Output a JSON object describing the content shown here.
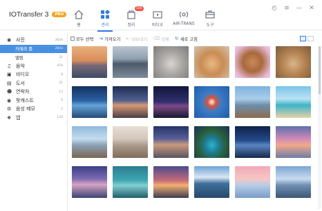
{
  "app": {
    "title": "IOTransfer 3",
    "badge": "PRO"
  },
  "nav": [
    {
      "label": "홈",
      "icon": "home-icon",
      "badge": ""
    },
    {
      "label": "관리",
      "icon": "manage-grid-icon",
      "badge": ""
    },
    {
      "label": "정리",
      "icon": "clean-icon",
      "badge": "500"
    },
    {
      "label": "비디오",
      "icon": "video-icon",
      "badge": ""
    },
    {
      "label": "AIR-TRANS",
      "icon": "air-trans-icon",
      "badge": ""
    },
    {
      "label": "도구",
      "icon": "toolbox-icon",
      "badge": ""
    }
  ],
  "active_nav": "관리",
  "window_controls": [
    "skin-icon",
    "menu-icon",
    "minimize-icon",
    "close-icon"
  ],
  "sidebar": {
    "items": [
      {
        "label": "사진",
        "count": "3644",
        "icon": "camera-icon",
        "sub": false,
        "selected": false
      },
      {
        "label": "카메라 롤",
        "count": "2843",
        "icon": "",
        "sub": true,
        "selected": true
      },
      {
        "label": "앨범",
        "count": "32",
        "icon": "",
        "sub": true,
        "selected": false
      },
      {
        "label": "음악",
        "count": "454",
        "icon": "music-icon",
        "sub": false,
        "selected": false
      },
      {
        "label": "비디오",
        "count": "8",
        "icon": "video-icon",
        "sub": false,
        "selected": false
      },
      {
        "label": "도서",
        "count": "21",
        "icon": "book-icon",
        "sub": false,
        "selected": false
      },
      {
        "label": "연락처",
        "count": "13",
        "icon": "contacts-icon",
        "sub": false,
        "selected": false
      },
      {
        "label": "팟캐스트",
        "count": "8",
        "icon": "podcast-icon",
        "sub": false,
        "selected": false
      },
      {
        "label": "음성 메모",
        "count": "2",
        "icon": "mic-icon",
        "sub": false,
        "selected": false
      },
      {
        "label": "앱",
        "count": "130",
        "icon": "apps-icon",
        "sub": false,
        "selected": false
      }
    ]
  },
  "toolbar": {
    "select_all": "모두 선택",
    "import": "가져오기",
    "export": "내보내기",
    "delete": "삭제",
    "refresh": "새로 고침"
  },
  "colors": {
    "accent": "#2f7be5",
    "selected": "#4a90e2",
    "badge": "#f0533f",
    "pro": "#f5a623"
  },
  "photos": [
    "sunset-pier",
    "lake-boats",
    "kitten-gray",
    "kitten-ginger",
    "cat-closeup",
    "kitten-tabby",
    "night-sea",
    "lighthouse-pier",
    "night-mountain",
    "skydiver",
    "sailboat-deck",
    "beach-palm",
    "wooden-pier",
    "wooden-pier-2",
    "lighthouse-night",
    "island-lagoon",
    "blue-mountain",
    "pink-sky",
    "pier-purple",
    "teal-pier",
    "sunset-field",
    "mountain-lake",
    "pink-horizon",
    "lake-rocks"
  ]
}
